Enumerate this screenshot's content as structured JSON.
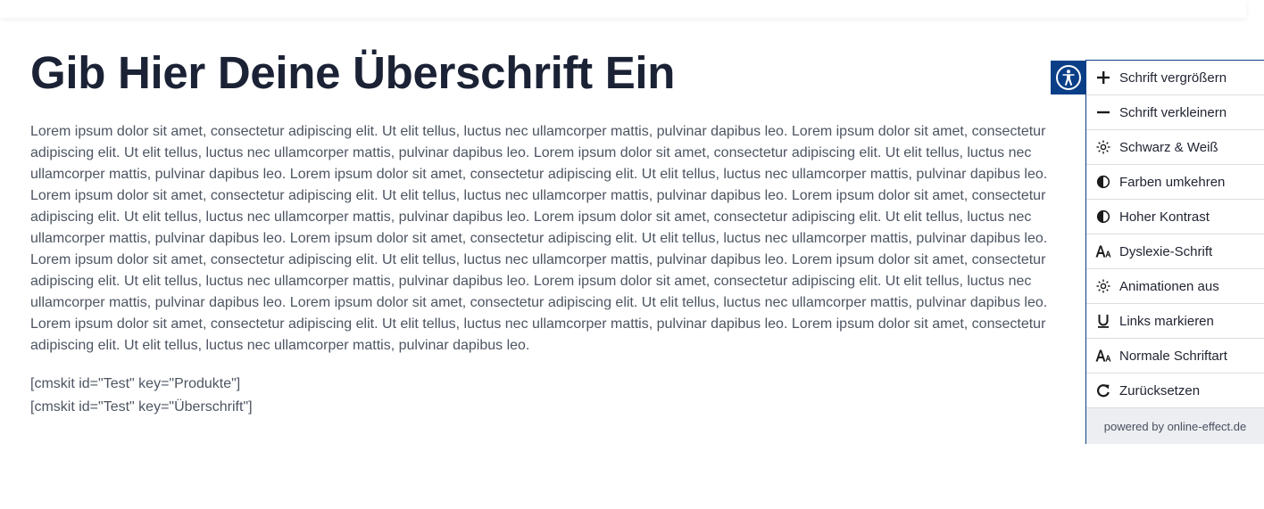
{
  "page": {
    "title": "Gib Hier Deine Überschrift Ein",
    "paragraph": "Lorem ipsum dolor sit amet, consectetur adipiscing elit. Ut elit tellus, luctus nec ullamcorper mattis, pulvinar dapibus leo. Lorem ipsum dolor sit amet, consectetur adipiscing elit. Ut elit tellus, luctus nec ullamcorper mattis, pulvinar dapibus leo. Lorem ipsum dolor sit amet, consectetur adipiscing elit. Ut elit tellus, luctus nec ullamcorper mattis, pulvinar dapibus leo. Lorem ipsum dolor sit amet, consectetur adipiscing elit. Ut elit tellus, luctus nec ullamcorper mattis, pulvinar dapibus leo. Lorem ipsum dolor sit amet, consectetur adipiscing elit. Ut elit tellus, luctus nec ullamcorper mattis, pulvinar dapibus leo. Lorem ipsum dolor sit amet, consectetur adipiscing elit. Ut elit tellus, luctus nec ullamcorper mattis, pulvinar dapibus leo. Lorem ipsum dolor sit amet, consectetur adipiscing elit. Ut elit tellus, luctus nec ullamcorper mattis, pulvinar dapibus leo. Lorem ipsum dolor sit amet, consectetur adipiscing elit. Ut elit tellus, luctus nec ullamcorper mattis, pulvinar dapibus leo. Lorem ipsum dolor sit amet, consectetur adipiscing elit. Ut elit tellus, luctus nec ullamcorper mattis, pulvinar dapibus leo. Lorem ipsum dolor sit amet, consectetur adipiscing elit. Ut elit tellus, luctus nec ullamcorper mattis, pulvinar dapibus leo. Lorem ipsum dolor sit amet, consectetur adipiscing elit. Ut elit tellus, luctus nec ullamcorper mattis, pulvinar dapibus leo. Lorem ipsum dolor sit amet, consectetur adipiscing elit. Ut elit tellus, luctus nec ullamcorper mattis, pulvinar dapibus leo. Lorem ipsum dolor sit amet, consectetur adipiscing elit. Ut elit tellus, luctus nec ullamcorper mattis, pulvinar dapibus leo. Lorem ipsum dolor sit amet, consectetur adipiscing elit. Ut elit tellus, luctus nec ullamcorper mattis, pulvinar dapibus leo.",
    "shortcodes": [
      "[cmskit id=\"Test\" key=\"Produkte\"]",
      "[cmskit id=\"Test\" key=\"Überschrift\"]"
    ]
  },
  "accessibility": {
    "toggle_icon": "accessibility-person-icon",
    "accent_color": "#0a3f88",
    "items": [
      {
        "label": "Schrift vergrößern",
        "icon": "plus-icon"
      },
      {
        "label": "Schrift verkleinern",
        "icon": "minus-icon"
      },
      {
        "label": "Schwarz & Weiß",
        "icon": "sun-icon"
      },
      {
        "label": "Farben umkehren",
        "icon": "half-circle-icon"
      },
      {
        "label": "Hoher Kontrast",
        "icon": "half-circle-icon"
      },
      {
        "label": "Dyslexie-Schrift",
        "icon": "font-icon"
      },
      {
        "label": "Animationen aus",
        "icon": "sun-icon"
      },
      {
        "label": "Links markieren",
        "icon": "underline-icon"
      },
      {
        "label": "Normale Schriftart",
        "icon": "font-icon"
      },
      {
        "label": "Zurücksetzen",
        "icon": "reset-icon"
      }
    ],
    "powered_by": "powered by online-effect.de"
  }
}
